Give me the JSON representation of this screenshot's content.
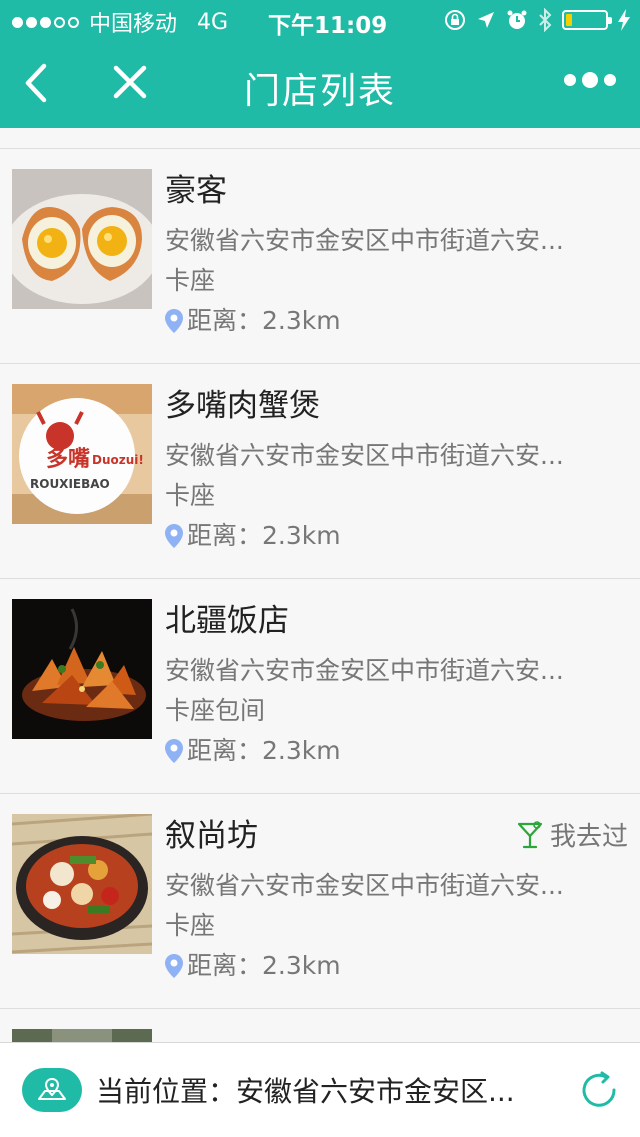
{
  "status_bar": {
    "carrier": "中国移动",
    "network": "4G",
    "time": "下午11:09",
    "signal_bars_filled": 3,
    "signal_bars_total": 5,
    "battery_level": 0.15
  },
  "nav": {
    "title": "门店列表",
    "icons": [
      "back-icon",
      "close-icon",
      "more-icon"
    ]
  },
  "stores": [
    {
      "name": "豪客",
      "address": "安徽省六安市金安区中市街道六安...",
      "seat": "卡座",
      "distance": "距离：2.3km",
      "visited": false,
      "image": "egg-toast"
    },
    {
      "name": "多嘴肉蟹煲",
      "address": "安徽省六安市金安区中市街道六安...",
      "seat": "卡座",
      "distance": "距离：2.3km",
      "visited": false,
      "image": "duozui-logo"
    },
    {
      "name": "北疆饭店",
      "address": "安徽省六安市金安区中市街道六安...",
      "seat": "卡座包间",
      "distance": "距离：2.3km",
      "visited": false,
      "image": "fried-dish"
    },
    {
      "name": "叙尚坊",
      "address": "安徽省六安市金安区中市街道六安...",
      "seat": "卡座",
      "distance": "距离：2.3km",
      "visited": true,
      "visited_label": "我去过",
      "image": "hotpot"
    }
  ],
  "logo": {
    "line1": "多嘴",
    "line2": "Duozui!",
    "line3": "ROUXIEBAO"
  },
  "bottom_bar": {
    "location_text": "当前位置：安徽省六安市金安区..."
  },
  "colors": {
    "accent": "#1fbba6",
    "pin": "#8fb2f5",
    "visited": "#2aa63a"
  }
}
